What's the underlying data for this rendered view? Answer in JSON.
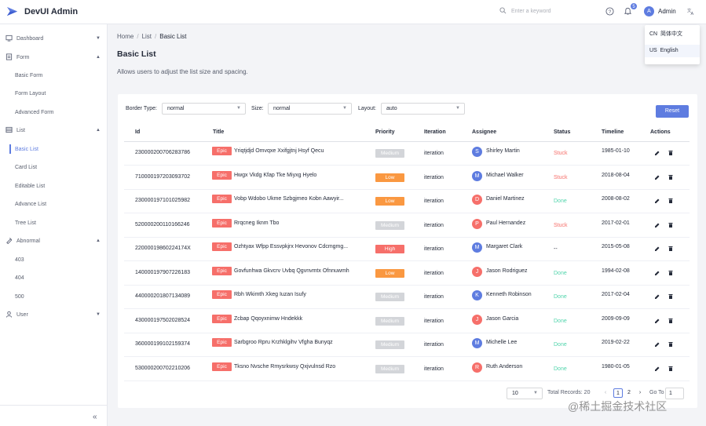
{
  "app": {
    "title": "DevUI Admin"
  },
  "header": {
    "search_placeholder": "Enter a keyword",
    "notification_count": "5",
    "user_initial": "A",
    "user_name": "Admin"
  },
  "language_menu": [
    {
      "code": "CN",
      "label": "简体中文"
    },
    {
      "code": "US",
      "label": "English"
    }
  ],
  "sidebar": {
    "items": [
      {
        "label": "Dashboard",
        "type": "group",
        "icon": "dashboard-icon",
        "arrow": "▼"
      },
      {
        "label": "Form",
        "type": "group",
        "icon": "form-icon",
        "arrow": "▲"
      },
      {
        "label": "Basic Form",
        "type": "sub"
      },
      {
        "label": "Form Layout",
        "type": "sub"
      },
      {
        "label": "Advanced Form",
        "type": "sub"
      },
      {
        "label": "List",
        "type": "group",
        "icon": "list-icon",
        "arrow": "▲"
      },
      {
        "label": "Basic List",
        "type": "sub",
        "active": true
      },
      {
        "label": "Card List",
        "type": "sub"
      },
      {
        "label": "Editable List",
        "type": "sub"
      },
      {
        "label": "Advance List",
        "type": "sub"
      },
      {
        "label": "Tree List",
        "type": "sub"
      },
      {
        "label": "Abnormal",
        "type": "group",
        "icon": "abnormal-icon",
        "arrow": "▲"
      },
      {
        "label": "403",
        "type": "sub"
      },
      {
        "label": "404",
        "type": "sub"
      },
      {
        "label": "500",
        "type": "sub"
      },
      {
        "label": "User",
        "type": "group",
        "icon": "user-icon",
        "arrow": "▼"
      }
    ],
    "collapse_label": "«"
  },
  "breadcrumb": {
    "items": [
      "Home",
      "List",
      "Basic List"
    ],
    "separator": "/"
  },
  "page": {
    "title": "Basic List",
    "description": "Allows users to adjust the list size and spacing."
  },
  "filters": {
    "border_type_label": "Border Type:",
    "border_type_value": "normal",
    "size_label": "Size:",
    "size_value": "normal",
    "layout_label": "Layout:",
    "layout_value": "auto",
    "reset_label": "Reset"
  },
  "table": {
    "columns": [
      "Id",
      "Title",
      "Priority",
      "Iteration",
      "Assignee",
      "Status",
      "Timeline",
      "Actions"
    ],
    "epic_label": "Epic",
    "rows": [
      {
        "id": "2300002007062837​86",
        "title": "Yriqtjdjd Omvqxe Xxifgjtnj Hsyf Qecu",
        "priority": "Medium",
        "iteration": "iteration",
        "initial": "S",
        "assignee": "Shirley Martin",
        "status": "Stuck",
        "timeline": "1985-01-10"
      },
      {
        "id": "710000197203093702",
        "title": "Hwgx Vkdg Kfap Tke Miyxg Hyelo",
        "priority": "Low",
        "iteration": "iteration",
        "initial": "M",
        "assignee": "Michael Walker",
        "status": "Stuck",
        "timeline": "2018-08-04"
      },
      {
        "id": "230000197101025982",
        "title": "Vobp Wdobo Ukme Szbgjmeo Kobn Aawyir...",
        "priority": "Low",
        "iteration": "iteration",
        "initial": "D",
        "assignee": "Daniel Martinez",
        "status": "Done",
        "timeline": "2008-08-02"
      },
      {
        "id": "520000200110166246",
        "title": "Rrqcneg Iknm Tbo",
        "priority": "Medium",
        "iteration": "iteration",
        "initial": "P",
        "assignee": "Paul Hernandez",
        "status": "Stuck",
        "timeline": "2017-02-01"
      },
      {
        "id": "22000019860224174X",
        "title": "Ozhtyax Wfpp Essvpkjrx Hevonov Cdcmgmg...",
        "priority": "High",
        "iteration": "iteration",
        "initial": "M",
        "assignee": "Margaret Clark",
        "status": "--",
        "timeline": "2015-05-08"
      },
      {
        "id": "140000197907226183",
        "title": "Govfunhwa Gkvcrv Uvbq Qgvnvmtx Ofnnuwmh",
        "priority": "Low",
        "iteration": "iteration",
        "initial": "J",
        "assignee": "Jason Rodriguez",
        "status": "Done",
        "timeline": "1994-02-08"
      },
      {
        "id": "440000201807134089",
        "title": "Rbh Wkimth Xkeg Iuzan Isufy",
        "priority": "Medium",
        "iteration": "iteration",
        "initial": "K",
        "assignee": "Kenneth Robinson",
        "status": "Done",
        "timeline": "2017-02-04"
      },
      {
        "id": "430000197502028524",
        "title": "Zcbap Qqoyxnimw Hndekkk",
        "priority": "Medium",
        "iteration": "iteration",
        "initial": "J",
        "assignee": "Jason Garcia",
        "status": "Done",
        "timeline": "2009-09-09"
      },
      {
        "id": "360000199102159374",
        "title": "Sarbgroo Rpru Krzhklgihv Vfgha Bunyqz",
        "priority": "Medium",
        "iteration": "iteration",
        "initial": "M",
        "assignee": "Michelle Lee",
        "status": "Done",
        "timeline": "2019-02-22"
      },
      {
        "id": "530000200702210206",
        "title": "Tksno Nvsche Rmysrkwsy Qxjvulnsd Rzo",
        "priority": "Medium",
        "iteration": "iteration",
        "initial": "R",
        "assignee": "Ruth Anderson",
        "status": "Done",
        "timeline": "1980-01-05"
      }
    ]
  },
  "pagination": {
    "page_size": "10",
    "total_label": "Total Records: 20",
    "prev": "‹",
    "pages": [
      "1",
      "2"
    ],
    "next": "›",
    "goto_label": "Go To",
    "goto_value": "1"
  },
  "watermark": "@稀土掘金技术社区",
  "colors": {
    "accent": "#5e7ce0",
    "epic": "#f66f6a",
    "priority_medium": "#d3d5d9",
    "priority_low": "#fa9841",
    "priority_high": "#f66f6a",
    "status_stuck": "#f66f6a",
    "status_done": "#50d4ab"
  }
}
